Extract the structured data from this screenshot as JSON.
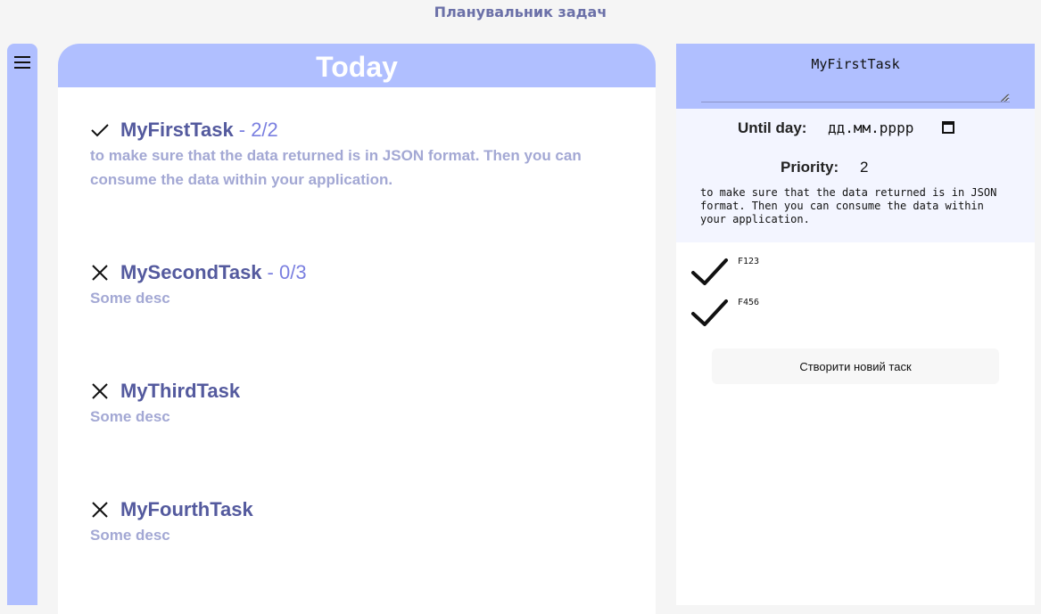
{
  "app": {
    "title": "Планувальник задач"
  },
  "sidebar": {
    "menu_icon": "hamburger-icon"
  },
  "main": {
    "header": "Today",
    "tasks": [
      {
        "name": "MyFirstTask",
        "progress": "- 2/2",
        "status": "check-icon",
        "desc": "to make sure that the data returned is in JSON format. Then you can consume the data within your application."
      },
      {
        "name": "MySecondTask",
        "progress": "- 0/3",
        "status": "cross-icon",
        "desc": "Some desc"
      },
      {
        "name": "MyThirdTask",
        "progress": "",
        "status": "cross-icon",
        "desc": "Some desc"
      },
      {
        "name": "MyFourthTask",
        "progress": "",
        "status": "cross-icon",
        "desc": "Some desc"
      }
    ]
  },
  "panel": {
    "name_value": "MyFirstTask",
    "until_label": "Until day:",
    "date_value": "дд.мм.рррр",
    "priority_label": "Priority:",
    "priority_value": "2",
    "desc": "to make sure that the data returned is in JSON format. Then you can consume the data within your application.",
    "subtasks": [
      {
        "label": "F123",
        "icon": "check-icon"
      },
      {
        "label": "F456",
        "icon": "check-icon"
      }
    ],
    "create_button": "Створити новий таск"
  },
  "colors": {
    "accent": "#b0bfff",
    "task_title": "#545a9e",
    "task_progress": "#7a7fe0",
    "task_desc": "#a3a8d4",
    "app_title": "#6b70a8"
  }
}
